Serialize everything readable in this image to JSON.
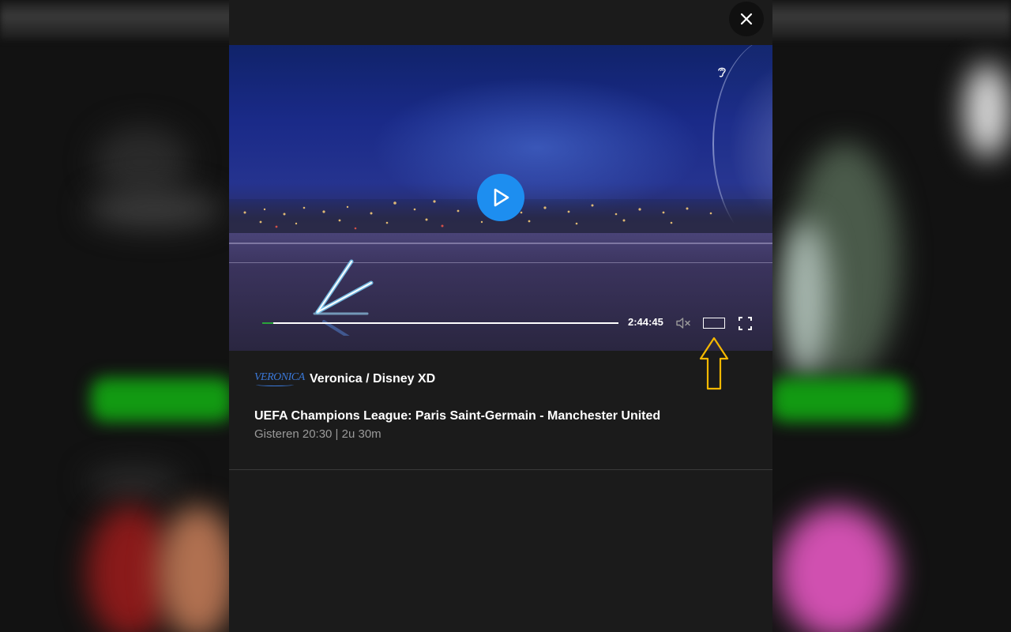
{
  "modal": {
    "close_icon": "close-icon",
    "player": {
      "play_icon": "play-icon",
      "accessibility_icon": "ear-icon",
      "progress_fraction": 0.03,
      "time_remaining": "2:44:45",
      "mute_icon": "volume-muted-icon",
      "theater_icon": "theater-mode-icon",
      "fullscreen_icon": "fullscreen-icon",
      "accent_color": "#1d8ef0",
      "progress_color": "#2aa43a"
    },
    "channel": {
      "logo_text": "VERONICA",
      "name": "Veronica / Disney XD"
    },
    "program": {
      "title": "UEFA Champions League: Paris Saint-Germain - Manchester United",
      "meta": "Gisteren 20:30 | 2u 30m"
    },
    "annotation": {
      "icon": "arrow-up-icon",
      "color": "#f5b800"
    }
  }
}
